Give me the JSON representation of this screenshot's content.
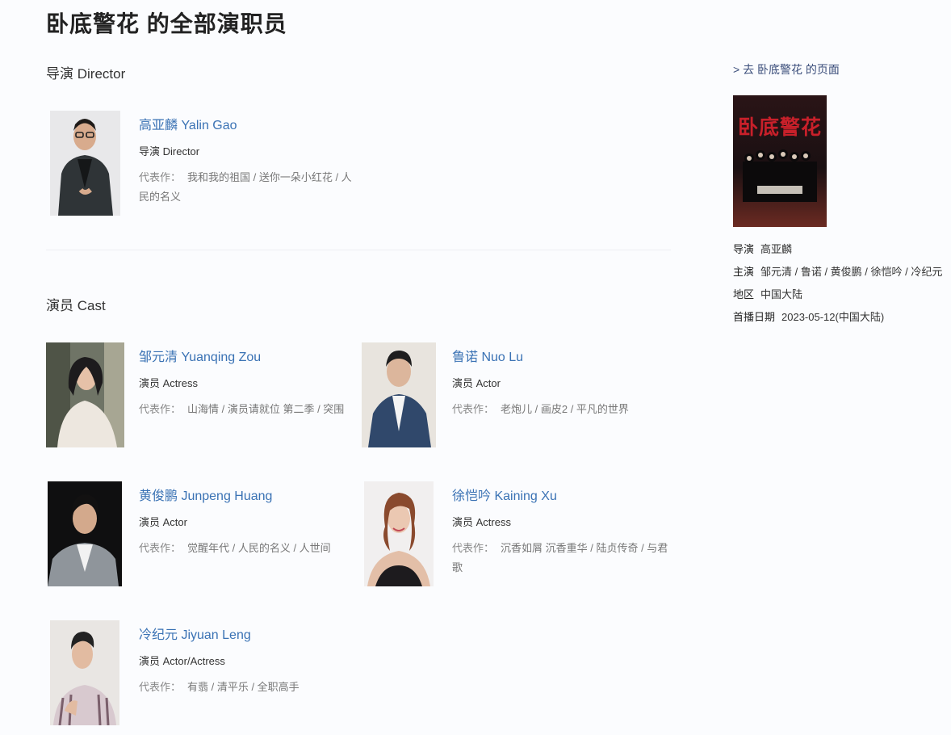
{
  "page": {
    "title": "卧底警花 的全部演职员"
  },
  "sections": {
    "director": "导演 Director",
    "cast": "演员 Cast"
  },
  "director": {
    "name": "高亚麟 Yalin Gao",
    "role": "导演 Director",
    "works_label": "代表作：",
    "works": "我和我的祖国 / 送你一朵小红花 / 人民的名义"
  },
  "cast": [
    {
      "name": "邹元清 Yuanqing Zou",
      "role": "演员 Actress",
      "works_label": "代表作：",
      "works": "山海情 / 演员请就位 第二季 / 突围"
    },
    {
      "name": "鲁诺 Nuo Lu",
      "role": "演员 Actor",
      "works_label": "代表作：",
      "works": "老炮儿 / 画皮2 / 平凡的世界"
    },
    {
      "name": "黄俊鹏 Junpeng Huang",
      "role": "演员 Actor",
      "works_label": "代表作：",
      "works": "觉醒年代 / 人民的名义 / 人世间"
    },
    {
      "name": "徐恺吟 Kaining Xu",
      "role": "演员 Actress",
      "works_label": "代表作：",
      "works": "沉香如屑 沉香重华 / 陆贞传奇 / 与君歌"
    },
    {
      "name": "冷纪元 Jiyuan Leng",
      "role": "演员 Actor/Actress",
      "works_label": "代表作：",
      "works": "有翡 / 清平乐 / 全职高手"
    }
  ],
  "sidebar": {
    "link": "> 去 卧底警花 的页面",
    "poster_title": "卧底警花",
    "meta": [
      {
        "label": "导演",
        "value": "高亚麟"
      },
      {
        "label": "主演",
        "value": "邹元清 / 鲁诺 / 黄俊鹏 / 徐恺吟 / 冷纪元"
      },
      {
        "label": "地区",
        "value": "中国大陆"
      },
      {
        "label": "首播日期",
        "value": "2023-05-12(中国大陆)"
      }
    ]
  },
  "colors": {
    "link": "#3a72b4",
    "poster_title": "#c8202a"
  }
}
